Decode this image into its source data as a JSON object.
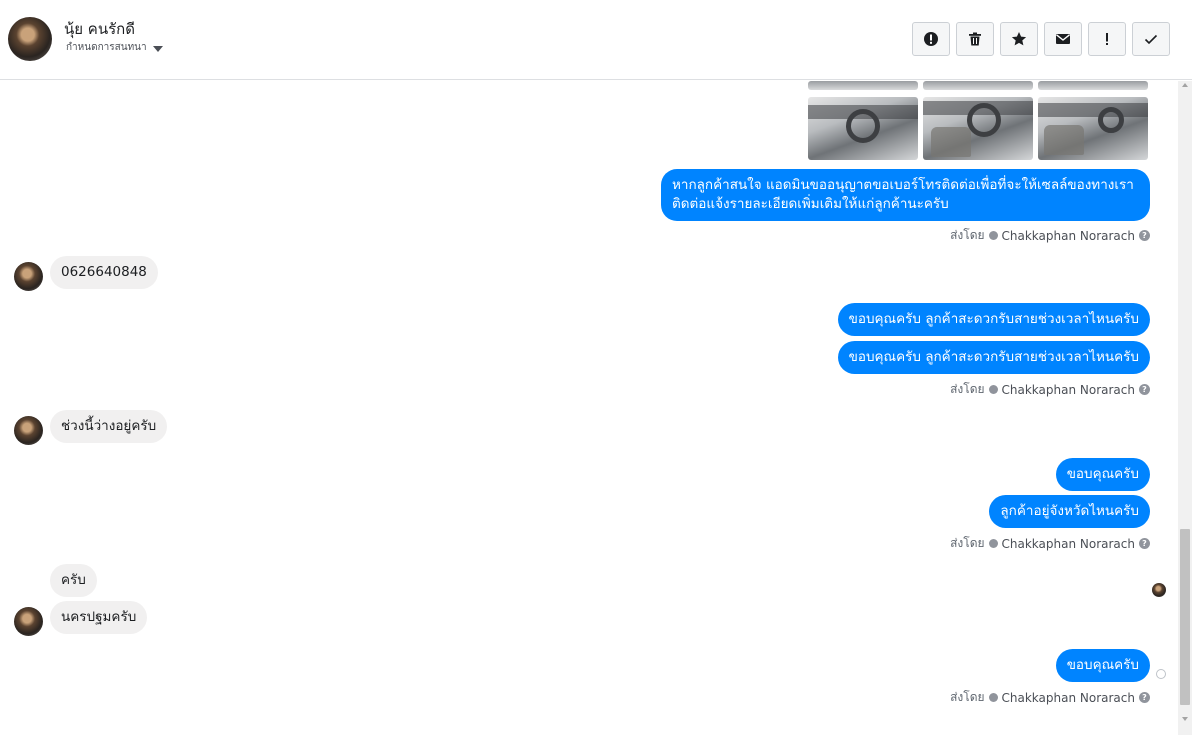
{
  "header": {
    "contact_name": "นุ้ย คนรักดี",
    "assign_label": "กำหนดการสนทนา"
  },
  "toolbar": {
    "icons": [
      "alert-circle-icon",
      "trash-icon",
      "star-icon",
      "envelope-icon",
      "exclamation-icon",
      "checkmark-icon"
    ]
  },
  "conversation": {
    "msg_out_1": "หากลูกค้าสนใจ แอดมินขออนุญาตขอเบอร์โทรติดต่อเพื่อที่จะให้เซลล์ของทางเราติดต่อแจ้งรายละเอียดเพิ่มเติมให้แก่ลูกค้านะครับ",
    "msg_in_phone": "0626640848",
    "msg_out_2": "ขอบคุณครับ ลูกค้าสะดวกรับสายช่วงเวลาไหนครับ",
    "msg_out_3": "ขอบคุณครับ ลูกค้าสะดวกรับสายช่วงเวลาไหนครับ",
    "msg_in_free": "ช่วงนี้ว่างอยู่ครับ",
    "msg_out_4": "ขอบคุณครับ",
    "msg_out_5": "ลูกค้าอยู่จังหวัดไหนครับ",
    "msg_in_yes": "ครับ",
    "msg_in_province": "นครปฐมครับ",
    "msg_out_6": "ขอบคุณครับ"
  },
  "sent_by": {
    "prefix": "ส่งโดย",
    "agent": "Chakkaphan Norarach",
    "help": "?"
  },
  "colors": {
    "outgoing_bubble": "#0084ff",
    "incoming_bubble": "#f1f0f0",
    "meta_text": "#606770"
  }
}
